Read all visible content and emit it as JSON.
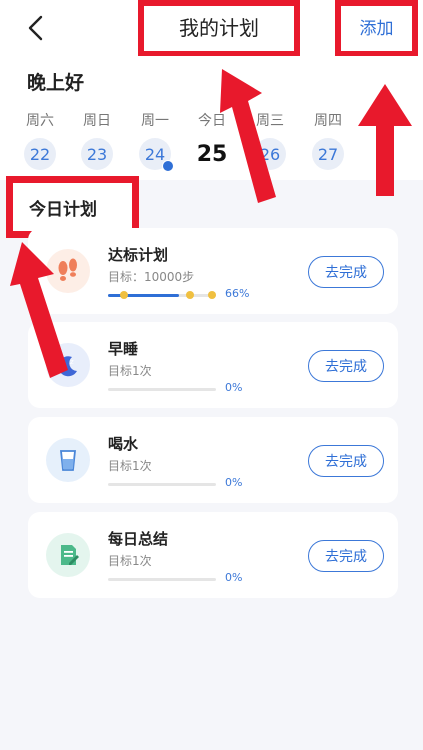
{
  "header": {
    "title": "我的计划",
    "add_label": "添加"
  },
  "greeting": "晚上好",
  "week": [
    {
      "weekday": "周六",
      "date": "22"
    },
    {
      "weekday": "周日",
      "date": "23"
    },
    {
      "weekday": "周一",
      "date": "24",
      "checked": true
    },
    {
      "weekday": "今日",
      "date": "25",
      "today": true
    },
    {
      "weekday": "周三",
      "date": "26"
    },
    {
      "weekday": "周四",
      "date": "27"
    }
  ],
  "section_title": "今日计划",
  "plans": [
    {
      "name": "达标计划",
      "goal": "目标：10000步",
      "progress": "66%",
      "progress_value": 0.66,
      "action": "去完成",
      "icon": "footprints-icon"
    },
    {
      "name": "早睡",
      "goal": "目标1次",
      "progress": "0%",
      "progress_value": 0,
      "action": "去完成",
      "icon": "moon-sleep-icon"
    },
    {
      "name": "喝水",
      "goal": "目标1次",
      "progress": "0%",
      "progress_value": 0,
      "action": "去完成",
      "icon": "water-glass-icon"
    },
    {
      "name": "每日总结",
      "goal": "目标1次",
      "progress": "0%",
      "progress_value": 0,
      "action": "去完成",
      "icon": "note-edit-icon"
    }
  ],
  "colors": {
    "accent": "#2f6fd6",
    "highlight_red": "#e8192c",
    "progress_dot": "#f0c040"
  }
}
